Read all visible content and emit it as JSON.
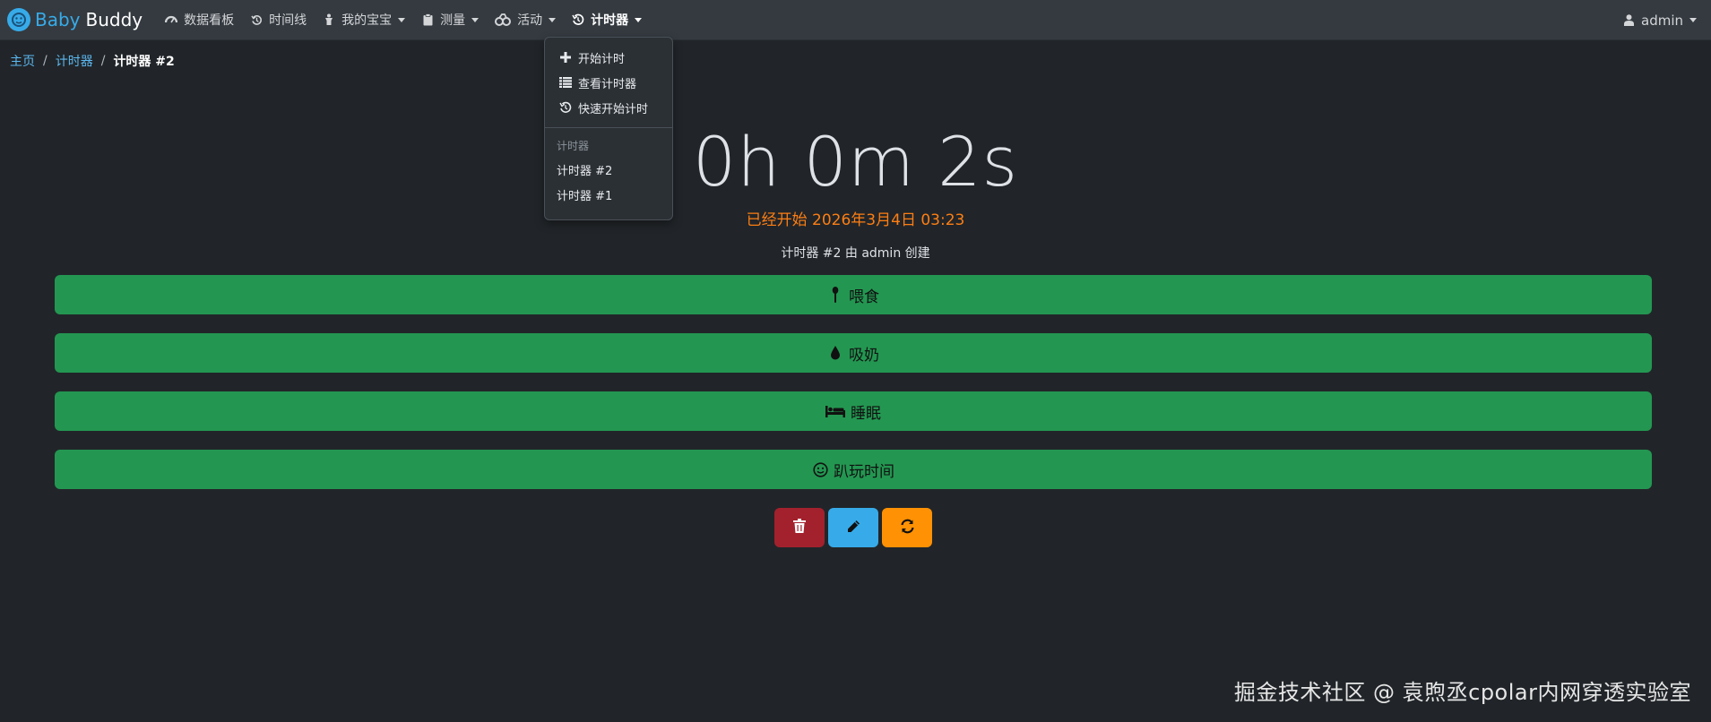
{
  "navbar": {
    "brand_part1": "Baby",
    "brand_part2": "Buddy",
    "items": [
      {
        "label": "数据看板",
        "icon": "dashboard-icon"
      },
      {
        "label": "时间线",
        "icon": "history-icon"
      },
      {
        "label": "我的宝宝",
        "icon": "baby-icon",
        "dropdown": true
      },
      {
        "label": "测量",
        "icon": "clipboard-icon",
        "dropdown": true
      },
      {
        "label": "活动",
        "icon": "activities-icon",
        "dropdown": true
      },
      {
        "label": "计时器",
        "icon": "timer-icon",
        "dropdown": true,
        "active": true
      }
    ],
    "user": "admin"
  },
  "breadcrumb": {
    "home": "主页",
    "timers": "计时器",
    "current": "计时器 #2"
  },
  "timer_dropdown": {
    "start_timer": "开始计时",
    "view_timers": "查看计时器",
    "quick_start": "快速开始计时",
    "section_header": "计时器",
    "timers": [
      "计时器 #2",
      "计时器 #1"
    ]
  },
  "timer": {
    "elapsed": "0h 0m 2s",
    "started_text": "已经开始 2026年3月4日 03:23",
    "created_text": "计时器 #2 由 admin 创建"
  },
  "activity_buttons": [
    {
      "label": "喂食",
      "icon": "spoon-icon"
    },
    {
      "label": "吸奶",
      "icon": "droplet-icon"
    },
    {
      "label": "睡眠",
      "icon": "bed-icon"
    },
    {
      "label": "趴玩时间",
      "icon": "smile-icon"
    }
  ],
  "colors": {
    "background": "#212529",
    "navbar": "#343a40",
    "activity_green": "#239751",
    "delete_red": "#a3212d",
    "edit_blue": "#37abe9",
    "restart_orange": "#ff9104",
    "started_orange": "#fd7e14",
    "link_blue": "#5cb8f0"
  },
  "watermark": "掘金技术社区 @ 袁煦丞cpolar内网穿透实验室"
}
